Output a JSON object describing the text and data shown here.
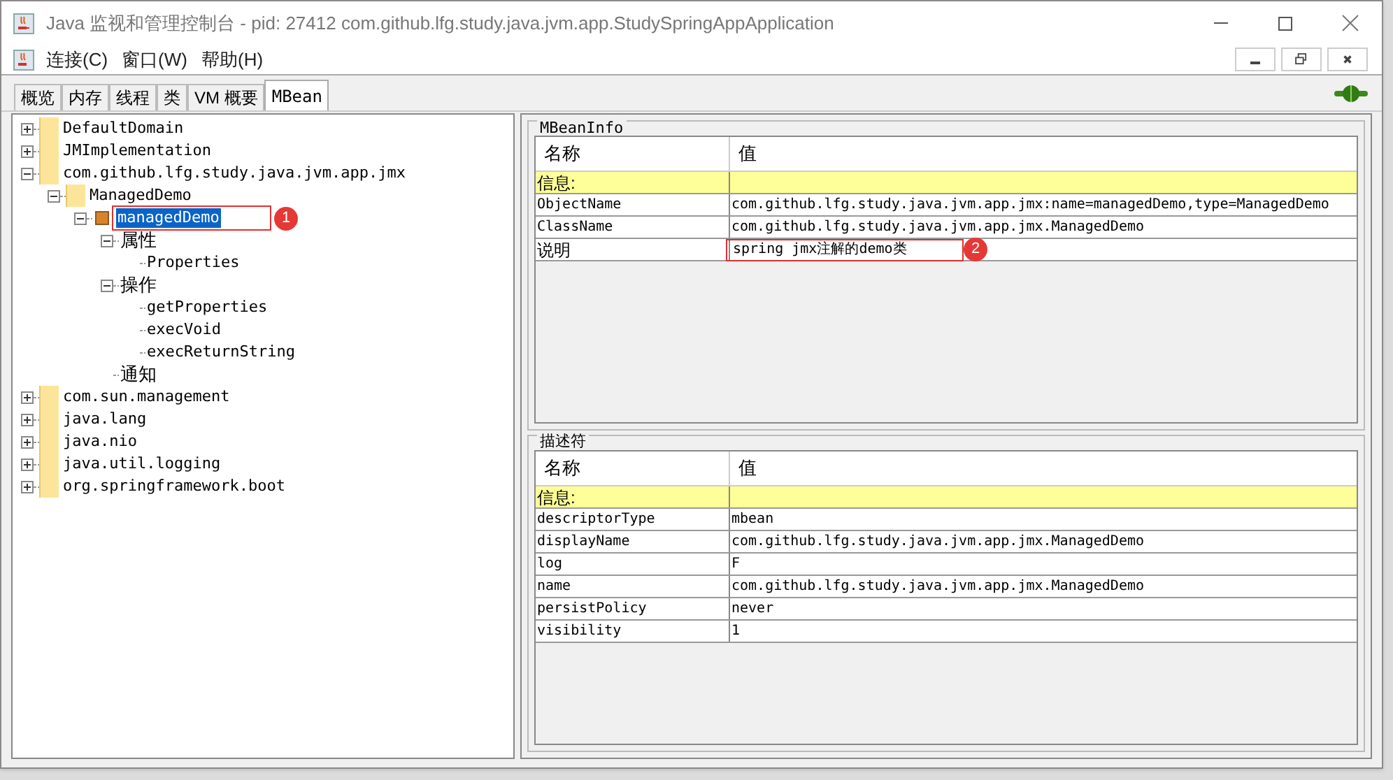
{
  "window": {
    "title": "Java 监视和管理控制台 - pid: 27412 com.github.lfg.study.java.jvm.app.StudySpringAppApplication"
  },
  "menu": [
    "连接(C)",
    "窗口(W)",
    "帮助(H)"
  ],
  "tabs": [
    {
      "label": "概览",
      "selected": false
    },
    {
      "label": "内存",
      "selected": false
    },
    {
      "label": "线程",
      "selected": false
    },
    {
      "label": "类",
      "selected": false
    },
    {
      "label": "VM 概要",
      "selected": false
    },
    {
      "label": "MBean",
      "selected": true
    }
  ],
  "tree": [
    {
      "label": "DefaultDomain",
      "kind": "domain",
      "expanded": false,
      "selected": false
    },
    {
      "label": "JMImplementation",
      "kind": "domain",
      "expanded": false,
      "selected": false
    },
    {
      "label": "com.github.lfg.study.java.jvm.app.jmx",
      "kind": "domain",
      "expanded": true,
      "selected": false,
      "children": [
        {
          "label": "ManagedDemo",
          "kind": "domain",
          "expanded": true,
          "selected": false,
          "children": [
            {
              "label": "managedDemo",
              "kind": "mbean",
              "expanded": true,
              "selected": true,
              "callout": "1",
              "children": [
                {
                  "label": "属性",
                  "kind": "category",
                  "expanded": true,
                  "selected": false,
                  "children": [
                    {
                      "label": "Properties",
                      "kind": "member",
                      "selected": false
                    }
                  ]
                },
                {
                  "label": "操作",
                  "kind": "category",
                  "expanded": true,
                  "selected": false,
                  "children": [
                    {
                      "label": "getProperties",
                      "kind": "member",
                      "selected": false
                    },
                    {
                      "label": "execVoid",
                      "kind": "member",
                      "selected": false
                    },
                    {
                      "label": "execReturnString",
                      "kind": "member",
                      "selected": false
                    }
                  ]
                },
                {
                  "label": "通知",
                  "kind": "category",
                  "selected": false
                }
              ]
            }
          ]
        }
      ]
    },
    {
      "label": "com.sun.management",
      "kind": "domain",
      "expanded": false,
      "selected": false
    },
    {
      "label": "java.lang",
      "kind": "domain",
      "expanded": false,
      "selected": false
    },
    {
      "label": "java.nio",
      "kind": "domain",
      "expanded": false,
      "selected": false
    },
    {
      "label": "java.util.logging",
      "kind": "domain",
      "expanded": false,
      "selected": false
    },
    {
      "label": "org.springframework.boot",
      "kind": "domain",
      "expanded": false,
      "selected": false
    }
  ],
  "mbean_info": {
    "title": "MBeanInfo",
    "columns": [
      "名称",
      "值"
    ],
    "rows": [
      {
        "kind": "section",
        "name": "信息:",
        "value": ""
      },
      {
        "kind": "row",
        "name": "ObjectName",
        "value": "com.github.lfg.study.java.jvm.app.jmx:name=managedDemo,type=ManagedDemo"
      },
      {
        "kind": "row",
        "name": "ClassName",
        "value": "com.github.lfg.study.java.jvm.app.jmx.ManagedDemo"
      },
      {
        "kind": "row",
        "name": "说明",
        "value": "spring jmx注解的demo类",
        "callout": "2"
      }
    ]
  },
  "descriptor": {
    "title": "描述符",
    "columns": [
      "名称",
      "值"
    ],
    "rows": [
      {
        "kind": "section",
        "name": "信息:",
        "value": ""
      },
      {
        "kind": "row",
        "name": "descriptorType",
        "value": "mbean"
      },
      {
        "kind": "row",
        "name": "displayName",
        "value": "com.github.lfg.study.java.jvm.app.jmx.ManagedDemo"
      },
      {
        "kind": "row",
        "name": "log",
        "value": "F"
      },
      {
        "kind": "row",
        "name": "name",
        "value": "com.github.lfg.study.java.jvm.app.jmx.ManagedDemo"
      },
      {
        "kind": "row",
        "name": "persistPolicy",
        "value": "never"
      },
      {
        "kind": "row",
        "name": "visibility",
        "value": "1"
      }
    ]
  }
}
